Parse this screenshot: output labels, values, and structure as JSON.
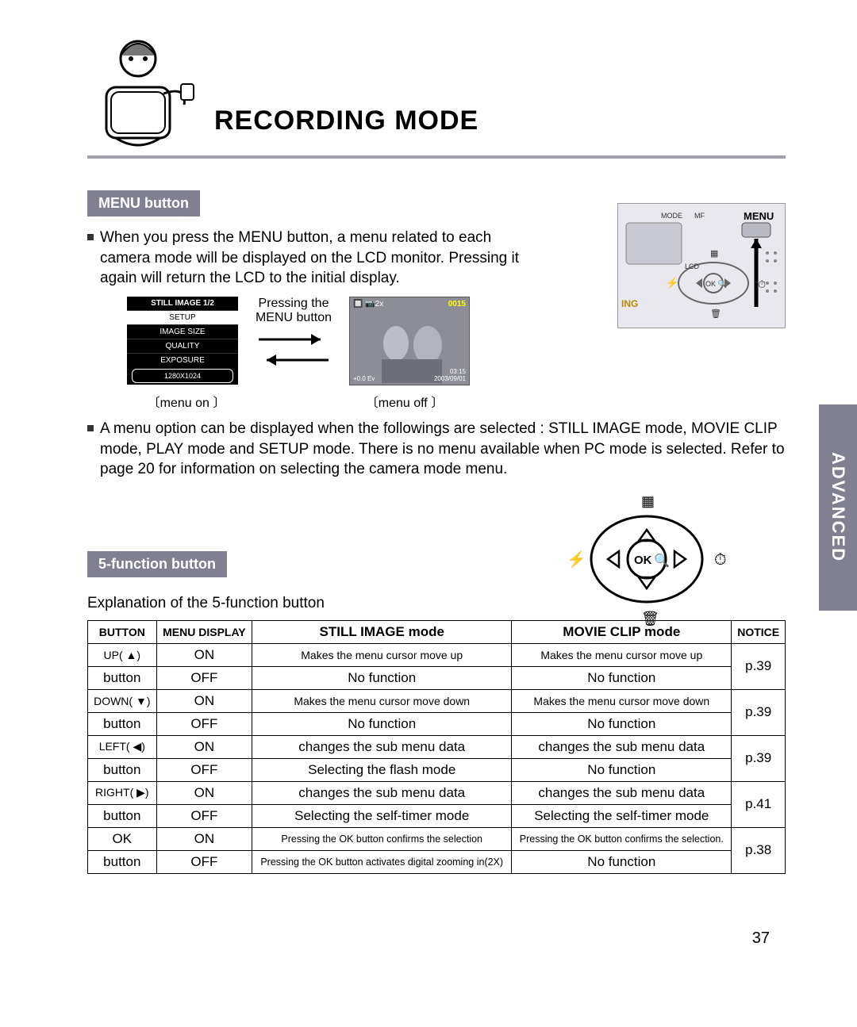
{
  "page_title": "RECORDING MODE",
  "side_tab": "ADVANCED",
  "page_number": "37",
  "section_menu": {
    "badge": "MENU button",
    "bullet1": "When you press the MENU button, a menu related to each camera mode will be displayed on the LCD monitor. Pressing it again will return the LCD to the initial display.",
    "press_label_1": "Pressing the",
    "press_label_2": "MENU button",
    "caption_on": "〔menu on 〕",
    "caption_off": "〔menu off 〕",
    "bullet2": "A menu option can be displayed when the followings are selected : STILL IMAGE mode, MOVIE CLIP mode, PLAY mode and SETUP mode. There is no menu available when PC mode is selected. Refer to page 20 for information on selecting the camera mode menu."
  },
  "lcd_menu": {
    "header": "STILL IMAGE 1/2",
    "rows": [
      "SETUP",
      "IMAGE SIZE",
      "QUALITY",
      "EXPOSURE"
    ],
    "footer": "1280X1024"
  },
  "lcd_photo": {
    "top_left": "🔲 📷2x",
    "top_right": "0015",
    "bottom_left": "+0.0 Ev",
    "bottom_right_1": "03:15",
    "bottom_right_2": "2003/09/01"
  },
  "camera_labels": {
    "mode": "MODE",
    "mf": "MF",
    "menu": "MENU",
    "lcd": "LCD",
    "ok": "OK",
    "ing": "ING"
  },
  "section_func": {
    "badge": "5-function button",
    "explain": "Explanation of the 5-function button"
  },
  "func_labels": {
    "ok": "OK"
  },
  "table": {
    "headers": [
      "BUTTON",
      "MENU DISPLAY",
      "STILL IMAGE mode",
      "MOVIE CLIP mode",
      "NOTICE"
    ],
    "rows": [
      {
        "btn": "UP( ▲)",
        "btn2": "button",
        "on": "ON",
        "off": "OFF",
        "still_on": "Makes the menu cursor move up",
        "still_off": "No function",
        "movie_on": "Makes the menu cursor move up",
        "movie_off": "No function",
        "notice": "p.39"
      },
      {
        "btn": "DOWN( ▼)",
        "btn2": "button",
        "on": "ON",
        "off": "OFF",
        "still_on": "Makes the menu cursor move down",
        "still_off": "No function",
        "movie_on": "Makes the menu cursor move down",
        "movie_off": "No function",
        "notice": "p.39"
      },
      {
        "btn": "LEFT( ◀)",
        "btn2": "button",
        "on": "ON",
        "off": "OFF",
        "still_on": "changes the sub menu data",
        "still_off": "Selecting the flash mode",
        "movie_on": "changes the sub menu data",
        "movie_off": "No function",
        "notice": "p.39"
      },
      {
        "btn": "RIGHT( ▶)",
        "btn2": "button",
        "on": "ON",
        "off": "OFF",
        "still_on": "changes the sub menu data",
        "still_off": "Selecting the self-timer mode",
        "movie_on": "changes the sub menu data",
        "movie_off": "Selecting the self-timer mode",
        "notice": "p.41"
      },
      {
        "btn": "OK",
        "btn2": "button",
        "on": "ON",
        "off": "OFF",
        "still_on": "Pressing the OK button confirms the selection",
        "still_off": "Pressing the OK button activates digital zooming in(2X)",
        "movie_on": "Pressing the OK button confirms the selection.",
        "movie_off": "No function",
        "notice": "p.38"
      }
    ]
  }
}
